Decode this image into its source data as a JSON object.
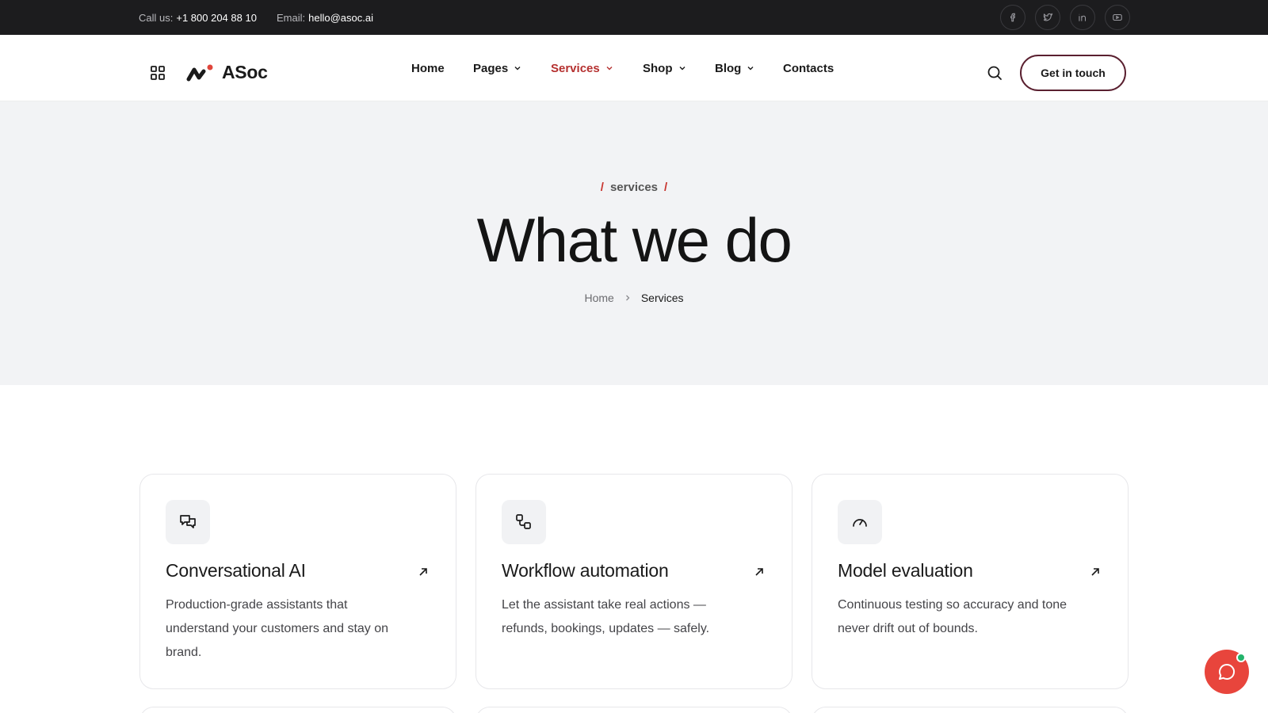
{
  "topbar": {
    "call_label": "Call us:",
    "call_value": "+1 800 204 88 10",
    "email_label": "Email:",
    "email_value": "hello@asoc.ai",
    "socials": [
      "facebook-icon",
      "twitter-icon",
      "linkedin-icon",
      "youtube-icon"
    ]
  },
  "header": {
    "logo_text": "ASoc",
    "nav": [
      {
        "label": "Home"
      },
      {
        "label": "Pages"
      },
      {
        "label": "Services"
      },
      {
        "label": "Shop"
      },
      {
        "label": "Blog"
      },
      {
        "label": "Contacts"
      }
    ],
    "cta_label": "Get in touch"
  },
  "hero": {
    "eyebrow": "services",
    "title": "What we do",
    "breadcrumb_home": "Home",
    "breadcrumb_current": "Services"
  },
  "cards": [
    {
      "title": "Conversational AI",
      "description": "Production-grade assistants that understand your customers and stay on brand.",
      "icon": "chat-bubbles-icon"
    },
    {
      "title": "Workflow automation",
      "description": "Let the assistant take real actions — refunds, bookings, updates — safely.",
      "icon": "workflow-icon"
    },
    {
      "title": "Model evaluation",
      "description": "Continuous testing so accuracy and tone never drift out of bounds.",
      "icon": "gauge-icon"
    }
  ],
  "colors": {
    "accent": "#b5302f",
    "topbar_bg": "#1c1c1e",
    "hero_bg": "#f2f3f5",
    "chat_bg": "#e8453c",
    "online": "#23b36b"
  }
}
